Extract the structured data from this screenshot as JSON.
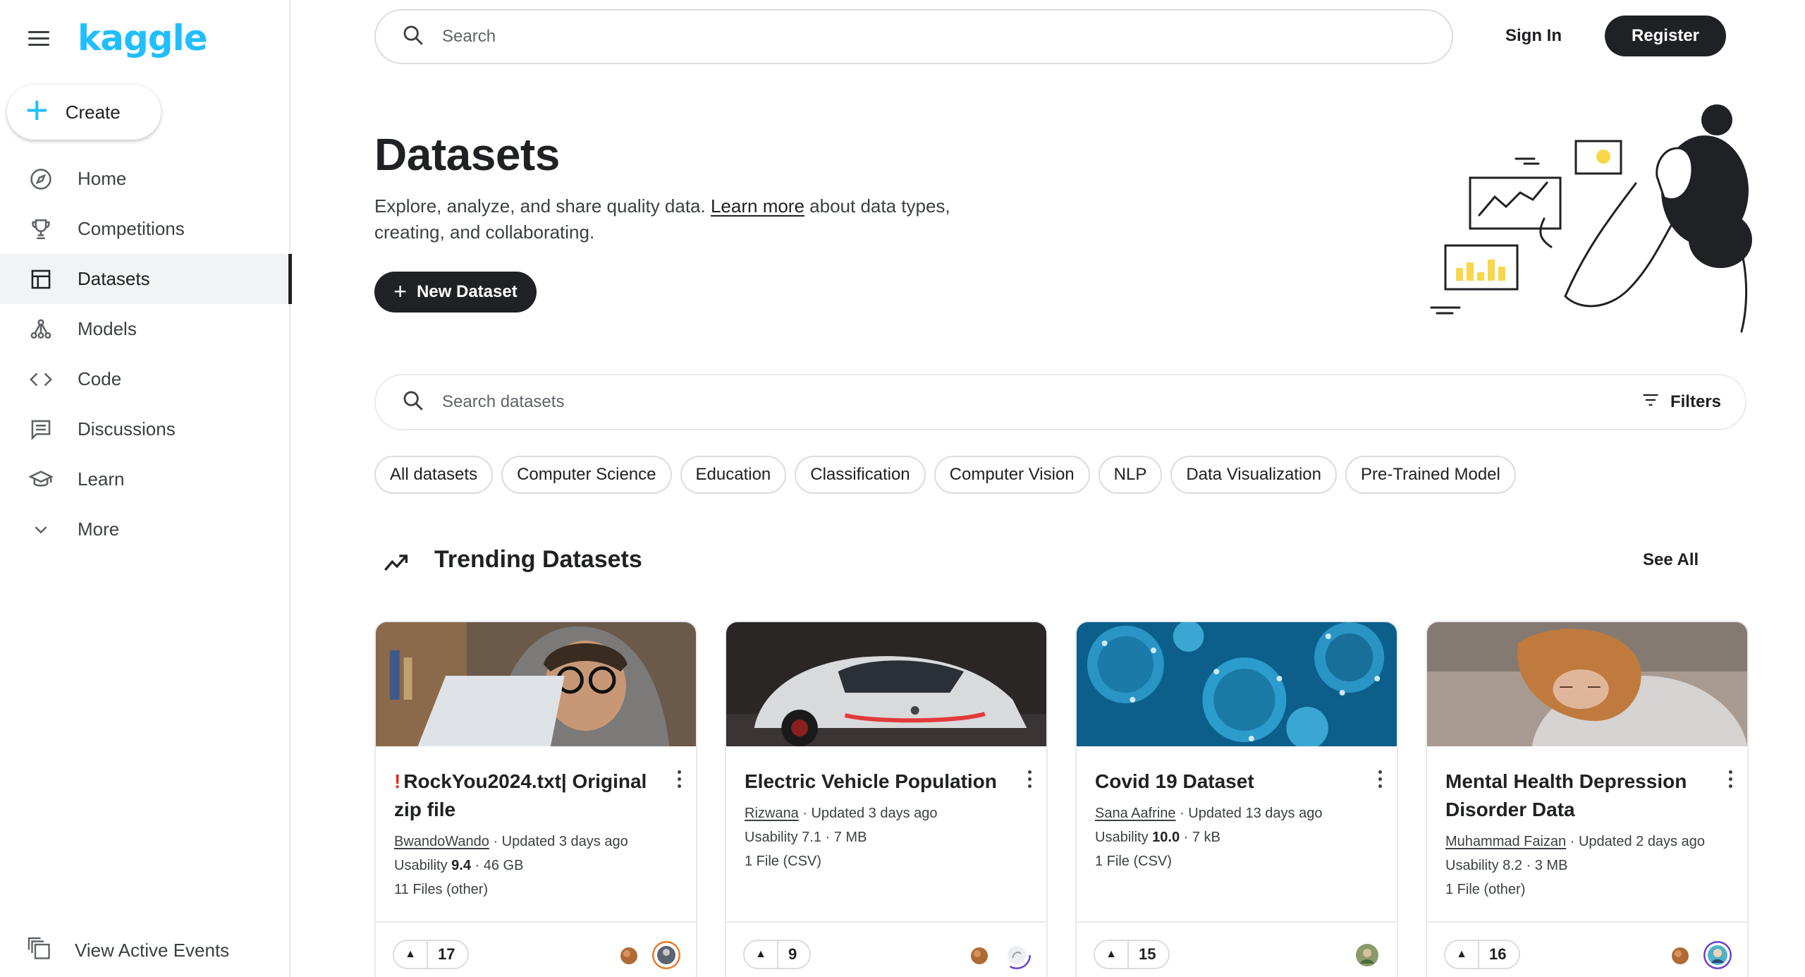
{
  "brand": {
    "logo_text": "kaggle",
    "accent": "#20beff"
  },
  "sidebar": {
    "create_label": "Create",
    "items": [
      {
        "label": "Home",
        "icon": "compass-icon"
      },
      {
        "label": "Competitions",
        "icon": "trophy-icon"
      },
      {
        "label": "Datasets",
        "icon": "table-icon",
        "active": true
      },
      {
        "label": "Models",
        "icon": "models-icon"
      },
      {
        "label": "Code",
        "icon": "code-icon"
      },
      {
        "label": "Discussions",
        "icon": "comments-icon"
      },
      {
        "label": "Learn",
        "icon": "school-icon"
      },
      {
        "label": "More",
        "icon": "chevron-down-icon"
      }
    ],
    "events_label": "View Active Events"
  },
  "topbar": {
    "search_placeholder": "Search",
    "signin_label": "Sign In",
    "register_label": "Register"
  },
  "header": {
    "title": "Datasets",
    "subtitle_pre": "Explore, analyze, and share quality data. ",
    "subtitle_link": "Learn more",
    "subtitle_post": " about data types, creating, and collaborating.",
    "new_dataset_label": "New Dataset"
  },
  "dataset_search": {
    "placeholder": "Search datasets",
    "filters_label": "Filters"
  },
  "chips": [
    "All datasets",
    "Computer Science",
    "Education",
    "Classification",
    "Computer Vision",
    "NLP",
    "Data Visualization",
    "Pre-Trained Model"
  ],
  "trending": {
    "title": "Trending Datasets",
    "see_all_label": "See All",
    "cards": [
      {
        "warning": "!",
        "title": "RockYou2024.txt| Original zip file",
        "owner": "BwandoWando",
        "updated": " · Updated 3 days ago",
        "usability_label": "Usability ",
        "usability": "9.4",
        "size": " · 46 GB",
        "files": "11 Files (other)",
        "votes": "17"
      },
      {
        "warning": "",
        "title": "Electric Vehicle Population",
        "owner": "Rizwana",
        "updated": " · Updated 3 days ago",
        "usability_label": "Usability ",
        "usability": "7.1",
        "size": " · 7 MB",
        "files": "1 File (CSV)",
        "votes": "9"
      },
      {
        "warning": "",
        "title": "Covid 19 Dataset",
        "owner": "Sana Aafrine",
        "updated": " · Updated 13 days ago",
        "usability_label": "Usability ",
        "usability": "10.0",
        "size": " · 7 kB",
        "files": "1 File (CSV)",
        "votes": "15"
      },
      {
        "warning": "",
        "title": "Mental Health Depression Disorder Data",
        "owner": "Muhammad Faizan",
        "updated": " · Updated 2 days ago",
        "usability_label": "Usability ",
        "usability": "8.2",
        "size": " · 3 MB",
        "files": "1 File (other)",
        "votes": "16"
      }
    ]
  }
}
